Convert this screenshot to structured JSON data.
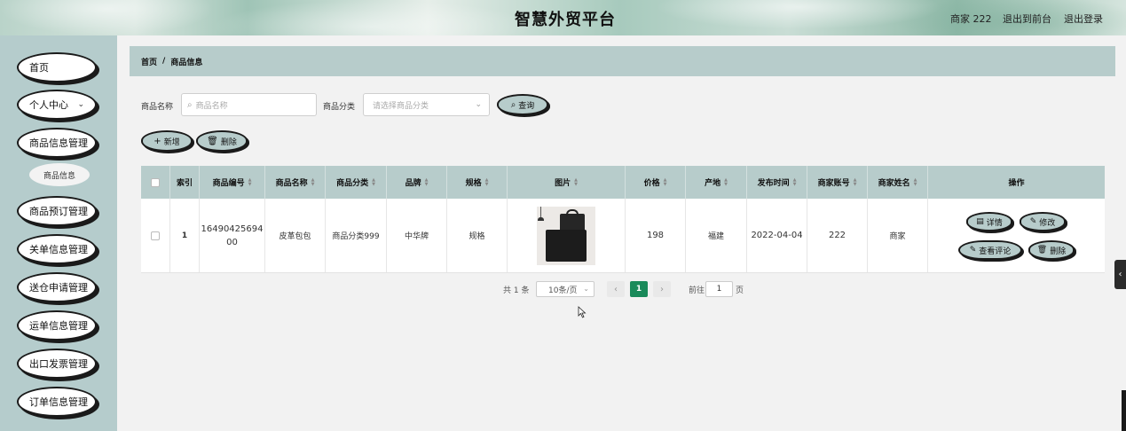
{
  "header": {
    "title": "智慧外贸平台",
    "user": "商家 222",
    "links": [
      "退出到前台",
      "退出登录"
    ]
  },
  "sidebar": {
    "items": [
      {
        "label": "首页"
      },
      {
        "label": "个人中心",
        "has_chevron": true
      },
      {
        "label": "商品信息管理"
      },
      {
        "label": "商品预订管理"
      },
      {
        "label": "关单信息管理"
      },
      {
        "label": "送仓申请管理"
      },
      {
        "label": "运单信息管理"
      },
      {
        "label": "出口发票管理"
      },
      {
        "label": "订单信息管理"
      }
    ],
    "subitem": "商品信息"
  },
  "breadcrumb": {
    "home": "首页",
    "sep": "/",
    "current": "商品信息"
  },
  "search": {
    "name_label": "商品名称",
    "name_placeholder": "商品名称",
    "category_label": "商品分类",
    "category_placeholder": "请选择商品分类",
    "query_button": "查询"
  },
  "actions": {
    "add": "新增",
    "delete": "删除"
  },
  "table": {
    "headers": [
      "索引",
      "商品编号",
      "商品名称",
      "商品分类",
      "品牌",
      "规格",
      "图片",
      "价格",
      "产地",
      "发布时间",
      "商家账号",
      "商家姓名",
      "操作"
    ],
    "rows": [
      {
        "index": "1",
        "code": "16490425694 00",
        "name": "皮革包包",
        "category": "商品分类999",
        "brand": "中华牌",
        "spec": "规格",
        "price": "198",
        "origin": "福建",
        "date": "2022-04-04",
        "account": "222",
        "merchant": "商家",
        "ops": [
          "详情",
          "修改",
          "查看评论",
          "删除"
        ]
      }
    ]
  },
  "pagination": {
    "total": "共 1 条",
    "page_size": "10条/页",
    "current_page": "1",
    "goto_label": "前往",
    "goto_value": "1",
    "page_unit": "页"
  },
  "colors": {
    "accent": "#b7cccb",
    "sidebar": "#b5cccc",
    "pager_active": "#1a8a5a"
  }
}
